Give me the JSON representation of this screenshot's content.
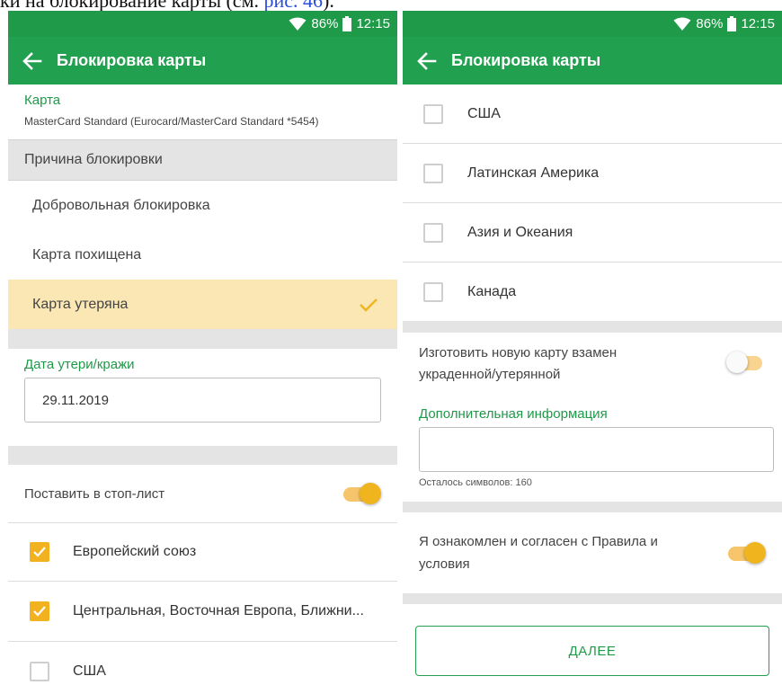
{
  "doc_caption": {
    "prefix": "ки на блокирование карты (см. ",
    "link": "рис. 46",
    "suffix": ")."
  },
  "status_bar": {
    "battery": "86%",
    "time": "12:15"
  },
  "app_bar": {
    "title": "Блокировка карты"
  },
  "left_screen": {
    "card": {
      "label": "Карта",
      "value": "MasterCard Standard (Eurocard/MasterCard Standard *5454)"
    },
    "reason_header": "Причина блокировки",
    "reasons": [
      {
        "label": "Добровольная блокировка",
        "selected": false
      },
      {
        "label": "Карта похищена",
        "selected": false
      },
      {
        "label": "Карта утеряна",
        "selected": true
      }
    ],
    "date": {
      "label": "Дата утери/кражи",
      "value": "29.11.2019"
    },
    "stop_list": {
      "label": "Поставить в стоп-лист",
      "on": true
    },
    "regions": [
      {
        "label": "Европейский союз",
        "checked": true
      },
      {
        "label": "Центральная, Восточная Европа, Ближни...",
        "checked": true
      },
      {
        "label": "США",
        "checked": false
      }
    ]
  },
  "right_screen": {
    "regions": [
      {
        "label": "США",
        "checked": false
      },
      {
        "label": "Латинская Америка",
        "checked": false
      },
      {
        "label": "Азия и Океания",
        "checked": false
      },
      {
        "label": "Канада",
        "checked": false
      }
    ],
    "new_card": {
      "line1": "Изготовить новую карту взамен",
      "line2": "украденной/утерянной",
      "on": false
    },
    "extra_info": {
      "label": "Дополнительная информация",
      "counter": "Осталось символов: 160"
    },
    "agree": {
      "line1": "Я ознакомлен и согласен с Правила и",
      "line2": "условия",
      "on": true
    },
    "next_label": "ДАЛЕЕ"
  },
  "colors": {
    "status_bar": "#1f9a48",
    "app_bar": "#21a14f",
    "accent_green": "#1e9a48",
    "selected_row": "#fbe7b3",
    "toggle_on": "#f0b51e",
    "checkbox_on": "#f2b21f",
    "section_gray": "#e4e4e4"
  },
  "icons": {
    "back": "arrow-left-icon",
    "wifi": "wifi-icon",
    "battery": "battery-icon",
    "selected": "checkmark-icon"
  }
}
